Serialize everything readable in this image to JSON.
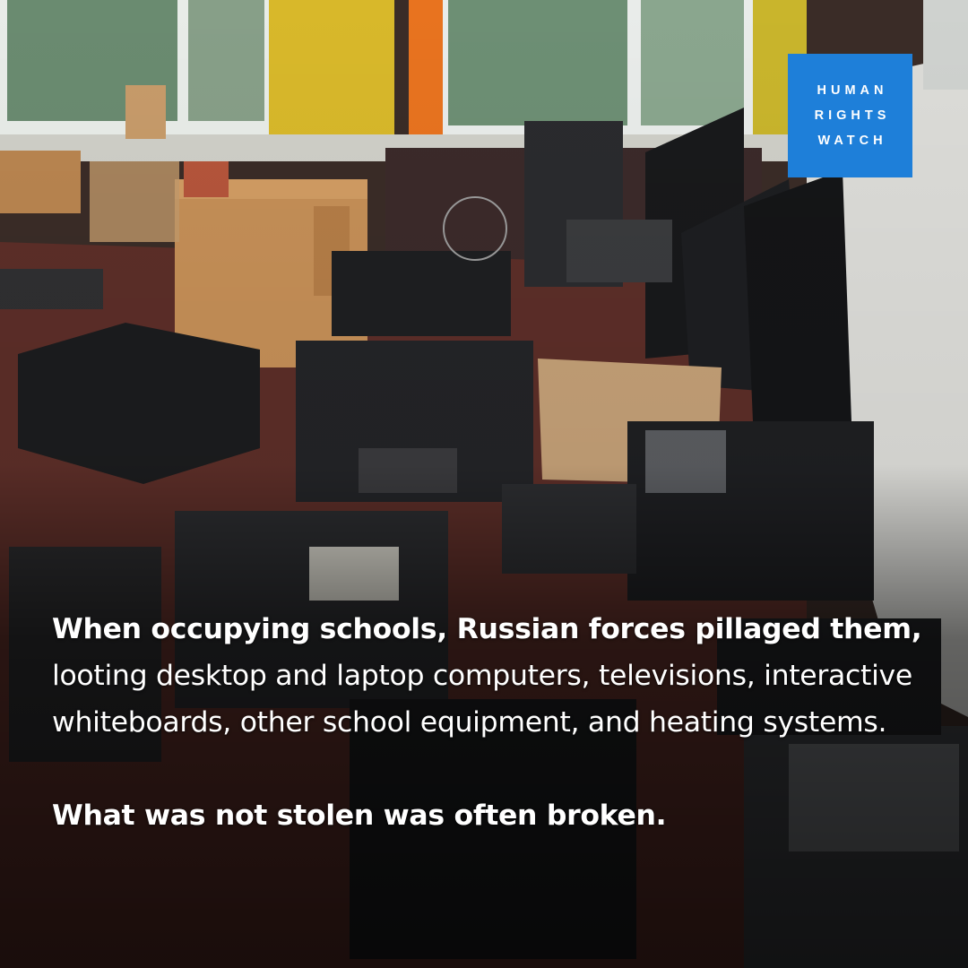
{
  "logo": {
    "lines": [
      "HUMAN",
      "RIGHTS",
      "WATCH"
    ],
    "color": "#1e7fd9"
  },
  "caption": {
    "lead_bold": "When occupying schools, Russian forces pillaged them,",
    "body": " looting desktop and laptop computers, televisions, interactive whiteboards, other school equipment, and heating systems.",
    "closing_bold": "What was not stolen was often broken."
  }
}
